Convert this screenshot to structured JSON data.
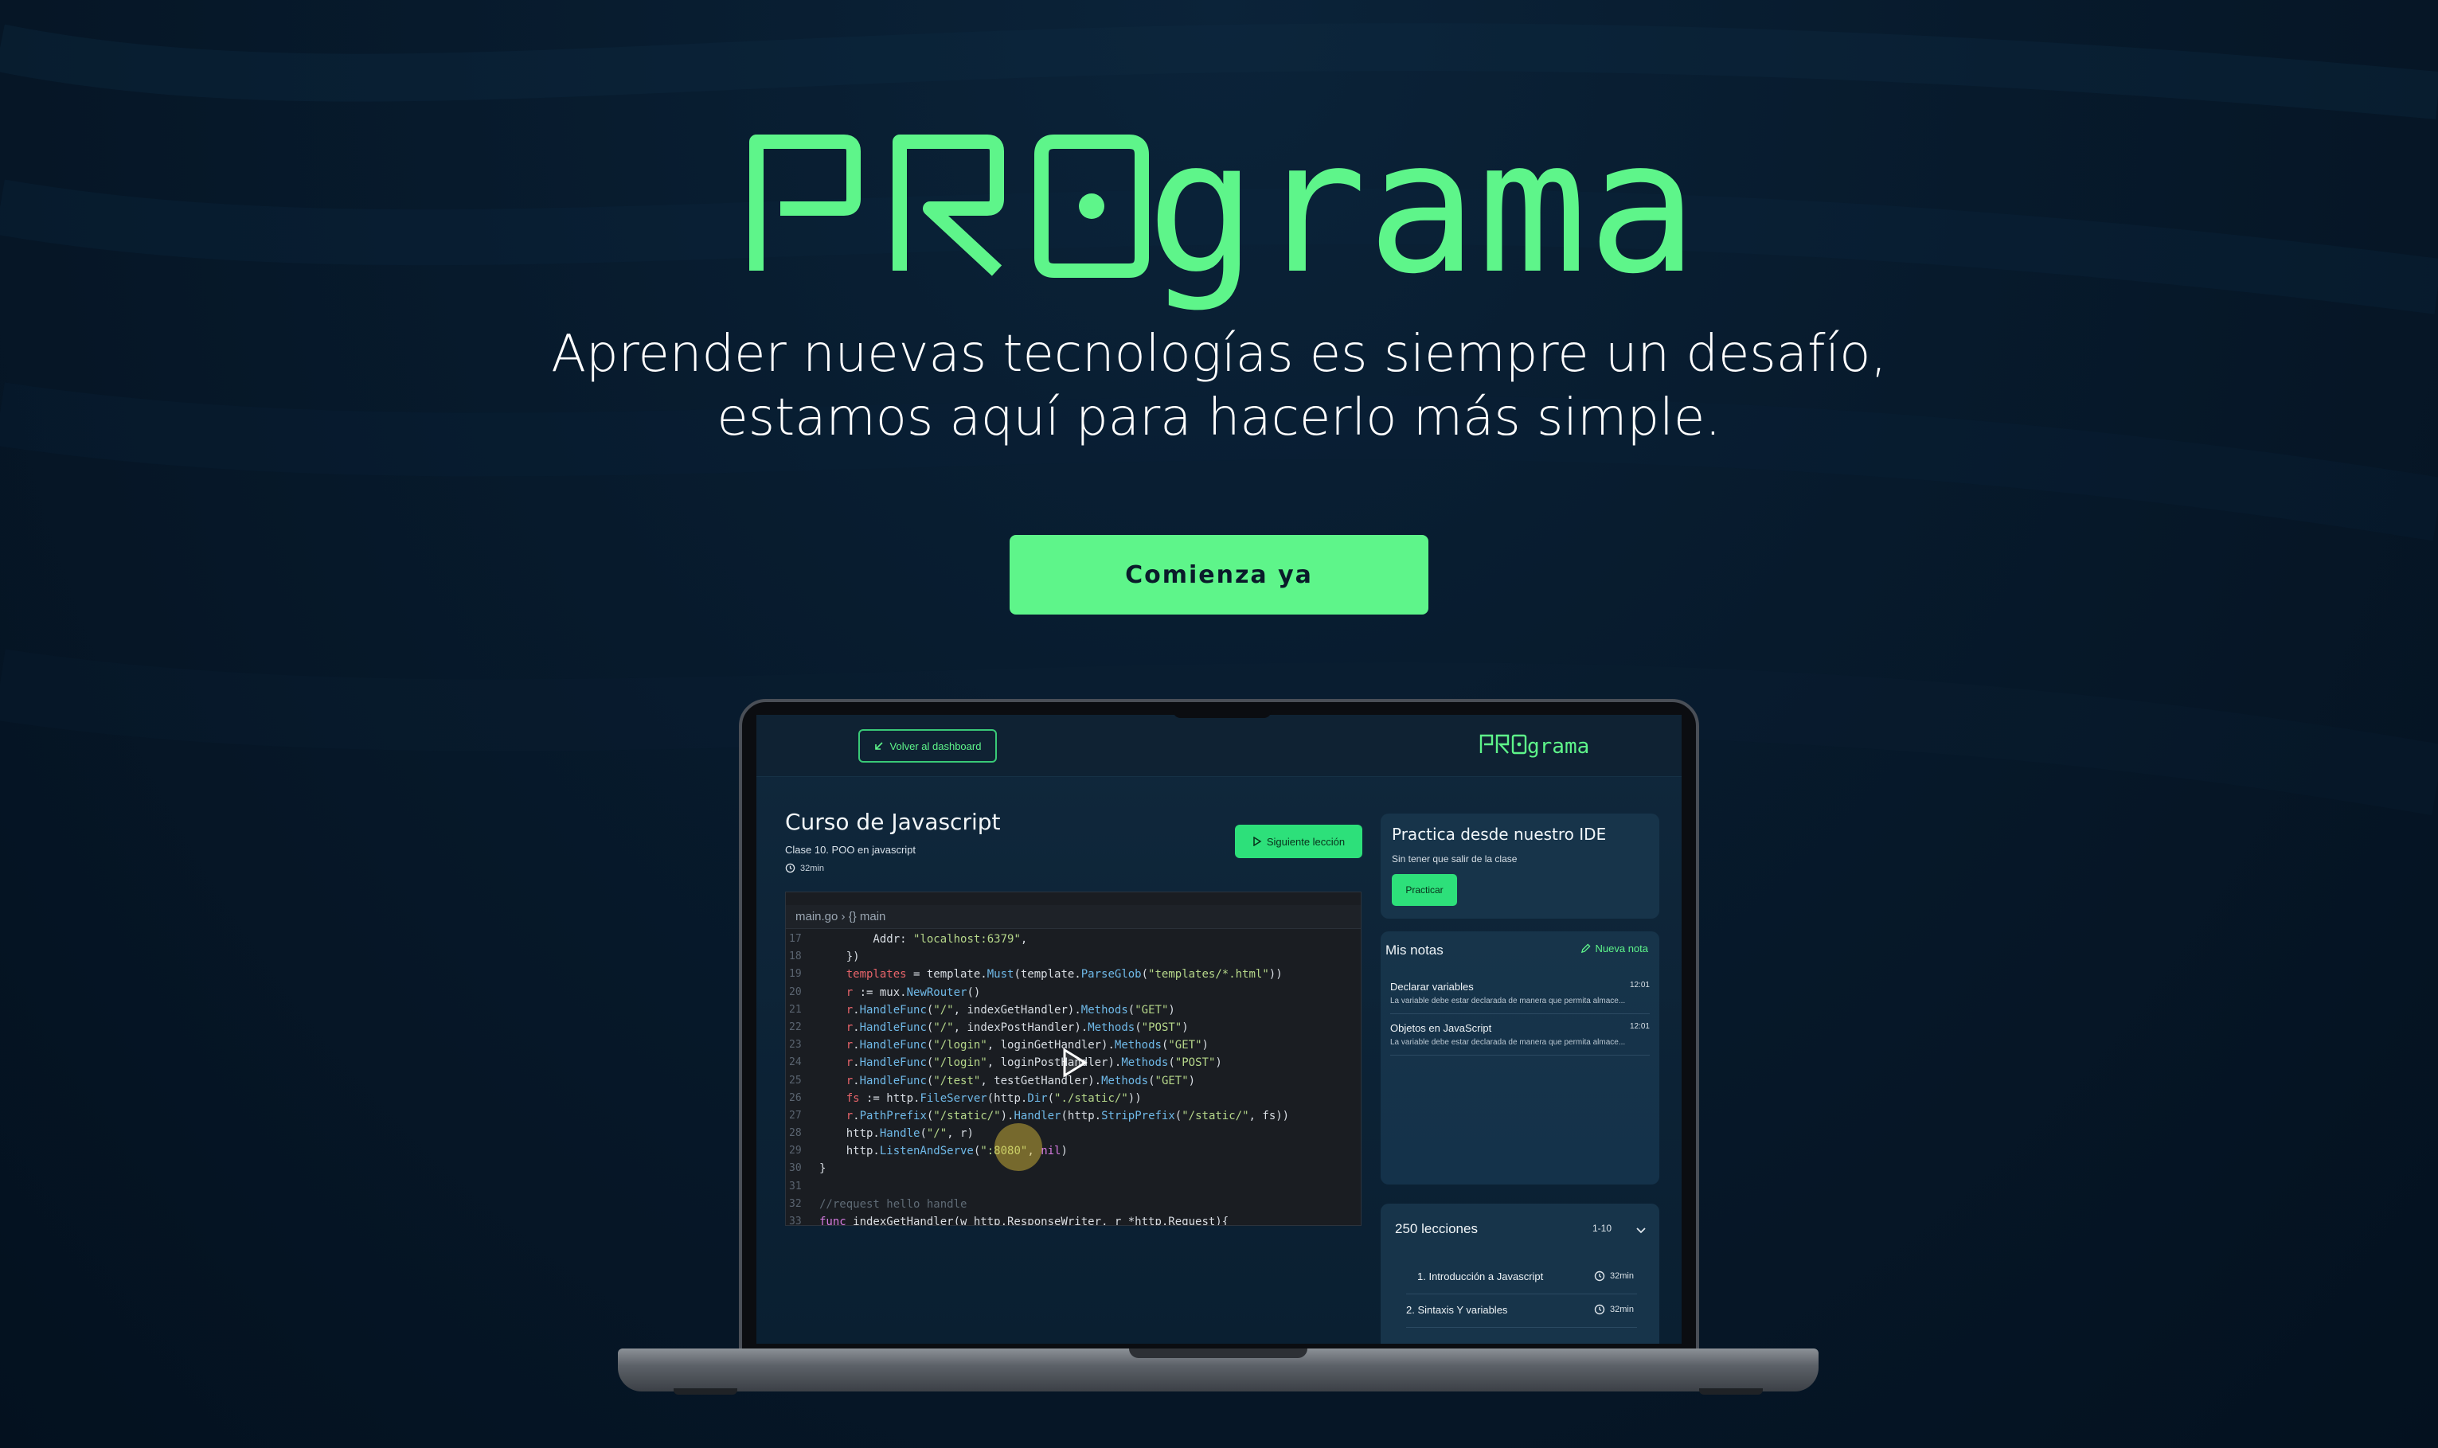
{
  "hero": {
    "logo_text": "PROgrama",
    "tagline_line1": "Aprender nuevas tecnologías es siempre un desafío,",
    "tagline_line2": "estamos aquí para hacerlo más simple.",
    "cta_label": "Comienza ya"
  },
  "colors": {
    "accent": "#5ef58a",
    "background": "#071a2c",
    "panel": "#17344a"
  },
  "app": {
    "back_label": "Volver al dashboard",
    "logo_text": "PROgrama",
    "course_title": "Curso de Javascript",
    "lesson_subtitle": "Clase 10. POO en javascript",
    "duration": "32min",
    "next_label": "Siguiente lección",
    "video": {
      "breadcrumb": "main.go  ›  {} main",
      "code": [
        {
          "ln": "17",
          "text": "        Addr: \"localhost:6379\","
        },
        {
          "ln": "18",
          "text": "    })"
        },
        {
          "ln": "19",
          "text": "    templates = template.Must(template.ParseGlob(\"templates/*.html\"))"
        },
        {
          "ln": "20",
          "text": "    r := mux.NewRouter()"
        },
        {
          "ln": "21",
          "text": "    r.HandleFunc(\"/\", indexGetHandler).Methods(\"GET\")"
        },
        {
          "ln": "22",
          "text": "    r.HandleFunc(\"/\", indexPostHandler).Methods(\"POST\")"
        },
        {
          "ln": "23",
          "text": "    r.HandleFunc(\"/login\", loginGetHandler).Methods(\"GET\")"
        },
        {
          "ln": "24",
          "text": "    r.HandleFunc(\"/login\", loginPostHandler).Methods(\"POST\")"
        },
        {
          "ln": "25",
          "text": "    r.HandleFunc(\"/test\", testGetHandler).Methods(\"GET\")"
        },
        {
          "ln": "26",
          "text": "    fs := http.FileServer(http.Dir(\"./static/\"))"
        },
        {
          "ln": "27",
          "text": "    r.PathPrefix(\"/static/\").Handler(http.StripPrefix(\"/static/\", fs))"
        },
        {
          "ln": "28",
          "text": "    http.Handle(\"/\", r)"
        },
        {
          "ln": "29",
          "text": "    http.ListenAndServe(\":8080\", nil)"
        },
        {
          "ln": "30",
          "text": "}"
        },
        {
          "ln": "31",
          "text": ""
        },
        {
          "ln": "32",
          "text": "//request hello handle"
        },
        {
          "ln": "33",
          "text": "func indexGetHandler(w http.ResponseWriter, r *http.Request){"
        }
      ]
    },
    "ide": {
      "title": "Practica desde nuestro IDE",
      "subtitle": "Sin tener que salir de la clase",
      "button": "Practicar"
    },
    "notes": {
      "title": "Mis notas",
      "new_label": "Nueva nota",
      "items": [
        {
          "title": "Declarar variables",
          "time": "12:01",
          "body": "La variable debe estar declarada de manera que permita almace..."
        },
        {
          "title": "Objetos en JavaScript",
          "time": "12:01",
          "body": "La variable debe estar declarada de manera que permita almace..."
        }
      ]
    },
    "lessons": {
      "title": "250 lecciones",
      "range": "1-10",
      "items": [
        {
          "name": "1. Introducción a Javascript",
          "time": "32min"
        },
        {
          "name": "2. Sintaxis Y variables",
          "time": "32min"
        }
      ]
    }
  }
}
